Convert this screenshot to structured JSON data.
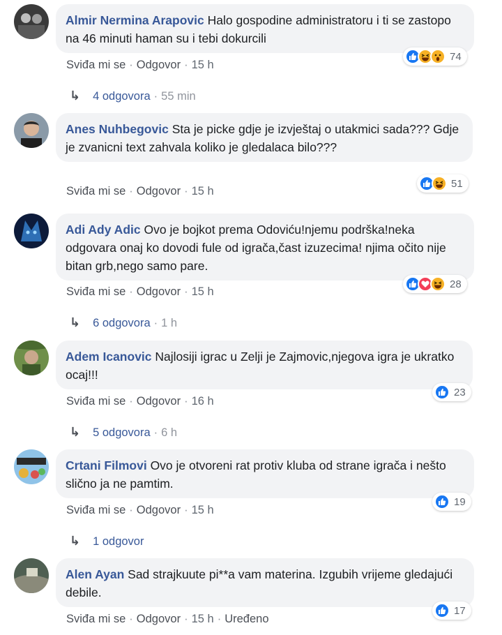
{
  "actions": {
    "like": "Sviđa mi se",
    "reply": "Odgovor",
    "edited": "Uređeno"
  },
  "comments": [
    {
      "author": "Almir Nermina Arapovic",
      "text": "Halo gospodine administratoru i ti se zastopo na 46 minuti haman su i tebi dokurcili",
      "time": "15 h",
      "reactions": [
        "like",
        "haha",
        "wow"
      ],
      "reaction_count": "74",
      "replies_label": "4 odgovora",
      "replies_time": "55 min"
    },
    {
      "author": "Anes Nuhbegovic",
      "text": "Sta je picke gdje je izvještaj o utakmici sada??? Gdje je zvanicni text zahvala koliko je gledalaca bilo???",
      "time": "15 h",
      "reactions": [
        "like",
        "haha"
      ],
      "reaction_count": "51"
    },
    {
      "author": "Adi Ady Adic",
      "text": "Ovo je bojkot prema Odoviću!njemu podrška!neka odgovara onaj ko dovodi fule od igrača,čast izuzecima! njima očito nije bitan grb,nego samo pare.",
      "time": "15 h",
      "reactions": [
        "like",
        "love",
        "haha"
      ],
      "reaction_count": "28",
      "replies_label": "6 odgovora",
      "replies_time": "1 h"
    },
    {
      "author": "Adem Icanovic",
      "text": "Najlosiji igrac u Zelji je Zajmovic,njegova igra je ukratko ocaj!!!",
      "time": "16 h",
      "reactions": [
        "like"
      ],
      "reaction_count": "23",
      "replies_label": "5 odgovora",
      "replies_time": "6 h"
    },
    {
      "author": "Crtani Filmovi",
      "text": "Ovo je otvoreni rat protiv kluba od strane igrača i nešto slično ja ne pamtim.",
      "time": "15 h",
      "reactions": [
        "like"
      ],
      "reaction_count": "19",
      "replies_label": "1 odgovor"
    },
    {
      "author": "Alen Ayan",
      "text": "Sad strajkuute pi**a vam materina. Izgubih vrijeme gledajući debile.",
      "time": "15 h",
      "edited": true,
      "reactions": [
        "like"
      ],
      "reaction_count": "17"
    }
  ]
}
